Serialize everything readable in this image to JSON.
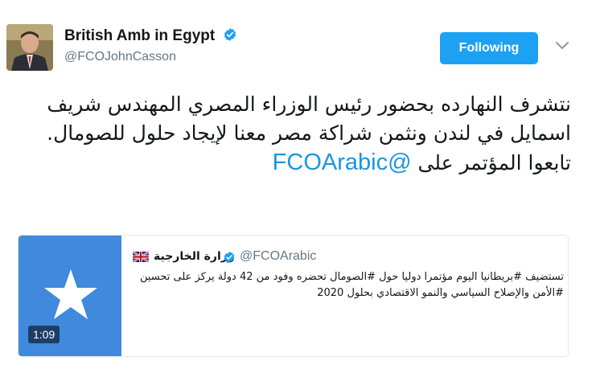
{
  "tweet": {
    "author_name": "British Amb in Egypt",
    "author_handle": "@FCOJohnCasson",
    "follow_label": "Following",
    "text": "نتشرف النهارده بحضور رئيس الوزراء المصري المهندس شريف اسمايل في لندن ونثمن شراكة مصر معنا لإيجاد حلول للصومال.",
    "text_line2": "تابعوا المؤتمر على",
    "mention": "@FCOArabic"
  },
  "quoted": {
    "name": "وزارة الخارجية",
    "handle": "@FCOArabic",
    "text": "تستضيف #بريطانيا اليوم مؤتمرا دوليا حول #الصومال تحضره وفود من 42 دولة يركز على تحسين #الأمن والإصلاح السياسي والنمو الاقتصادي بحلول 2020",
    "video_duration": "1:09"
  },
  "colors": {
    "accent": "#1da1f2",
    "link": "#1b95e0",
    "muted": "#657786",
    "media_bg": "#4189dd"
  },
  "icons": {
    "verified": "verified-badge-icon",
    "caret": "chevron-down-icon",
    "flag": "uk-flag-icon",
    "media": "somalia-flag-star"
  }
}
